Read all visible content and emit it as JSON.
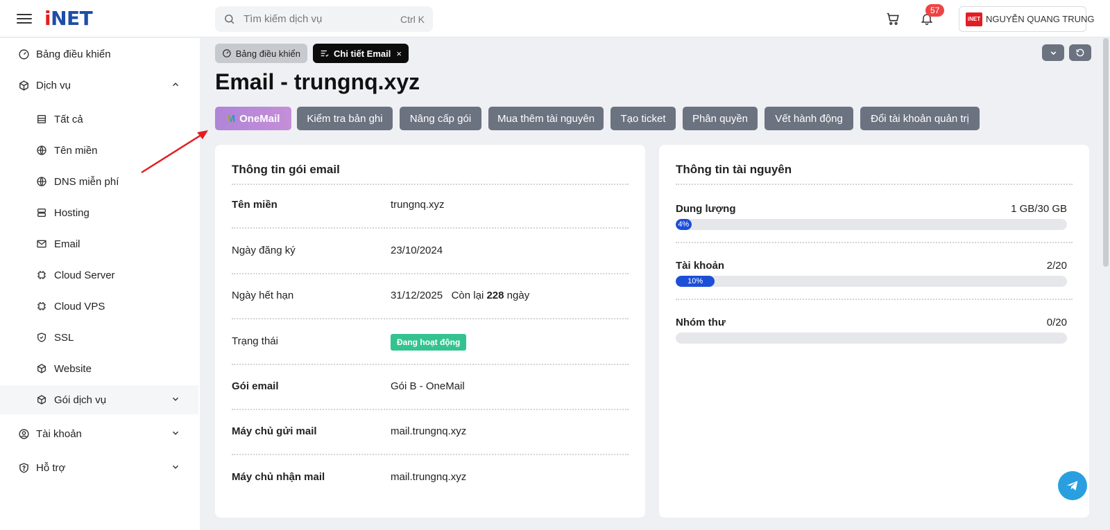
{
  "header": {
    "logo_prefix": "i",
    "logo_rest": "NET",
    "search_placeholder": "Tìm kiếm dịch vụ",
    "search_shortcut": "Ctrl K",
    "notification_count": "57",
    "user_avatar": "iNET",
    "user_name": "NGUYỄN QUANG TRUNG"
  },
  "sidebar": {
    "items": [
      {
        "label": "Bảng điều khiển",
        "icon": "gauge-icon"
      },
      {
        "label": "Dịch vụ",
        "icon": "box-icon"
      },
      {
        "label": "Tất cả",
        "icon": "list-icon"
      },
      {
        "label": "Tên miền",
        "icon": "globe-icon"
      },
      {
        "label": "DNS miễn phí",
        "icon": "globe-icon"
      },
      {
        "label": "Hosting",
        "icon": "server-icon"
      },
      {
        "label": "Email",
        "icon": "mail-icon"
      },
      {
        "label": "Cloud Server",
        "icon": "chip-icon"
      },
      {
        "label": "Cloud VPS",
        "icon": "chip-icon"
      },
      {
        "label": "SSL",
        "icon": "shield-check-icon"
      },
      {
        "label": "Website",
        "icon": "cube-icon"
      },
      {
        "label": "Gói dịch vụ",
        "icon": "box-icon"
      },
      {
        "label": "Tài khoản",
        "icon": "user-circle-icon"
      },
      {
        "label": "Hỗ trợ",
        "icon": "shield-question-icon"
      }
    ]
  },
  "tabs": {
    "dashboard": "Bảng điều khiển",
    "email_detail": "Chi tiết Email",
    "close": "×"
  },
  "page_title": "Email - trungnq.xyz",
  "actions": {
    "onemail_m": "M",
    "onemail": "OneMail",
    "check_records": "Kiểm tra bản ghi",
    "upgrade": "Nâng cấp gói",
    "buy_more": "Mua thêm tài nguyên",
    "create_ticket": "Tạo ticket",
    "permissions": "Phân quyền",
    "action_log": "Vết hành động",
    "change_admin": "Đổi tài khoản quản trị"
  },
  "package_info": {
    "title": "Thông tin gói email",
    "rows": {
      "domain_label": "Tên miền",
      "domain_value": "trungnq.xyz",
      "reg_label": "Ngày đăng ký",
      "reg_value": "23/10/2024",
      "exp_label": "Ngày hết hạn",
      "exp_value": "31/12/2025",
      "remaining_prefix": "Còn lại",
      "remaining_days": "228",
      "remaining_suffix": "ngày",
      "status_label": "Trạng thái",
      "status_value": "Đang hoạt động",
      "package_label": "Gói email",
      "package_value": "Gói B - OneMail",
      "smtp_label": "Máy chủ gửi mail",
      "smtp_value": "mail.trungnq.xyz",
      "imap_label": "Máy chủ nhận mail",
      "imap_value": "mail.trungnq.xyz"
    }
  },
  "resources": {
    "title": "Thông tin tài nguyên",
    "storage_label": "Dung lượng",
    "storage_value": "1 GB/30 GB",
    "storage_pct": "4%",
    "storage_fraction": 0.04,
    "accounts_label": "Tài khoản",
    "accounts_value": "2/20",
    "accounts_pct": "10%",
    "accounts_fraction": 0.1,
    "groups_label": "Nhóm thư",
    "groups_value": "0/20",
    "groups_fraction": 0
  },
  "colors": {
    "brand_blue": "#1e4ea8",
    "brand_red": "#e31d23",
    "action_button": "#6b7280",
    "status_green": "#34c38f",
    "progress_blue": "#1d4ed8"
  }
}
